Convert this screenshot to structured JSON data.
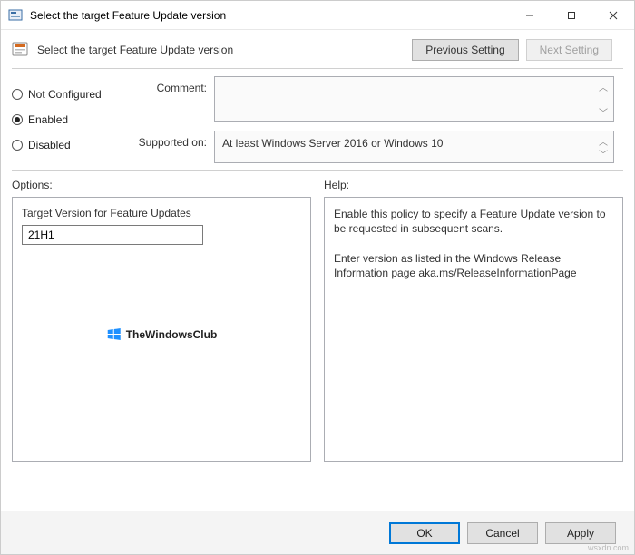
{
  "window": {
    "title": "Select the target Feature Update version"
  },
  "header": {
    "policy_title": "Select the target Feature Update version",
    "prev_btn": "Previous Setting",
    "next_btn": "Next Setting"
  },
  "config": {
    "radios": {
      "not_configured": "Not Configured",
      "enabled": "Enabled",
      "disabled": "Disabled",
      "selected": "enabled"
    },
    "comment_label": "Comment:",
    "comment_value": "",
    "supported_label": "Supported on:",
    "supported_value": "At least Windows Server 2016 or Windows 10"
  },
  "panels": {
    "options_label": "Options:",
    "help_label": "Help:"
  },
  "options": {
    "target_version_label": "Target Version for Feature Updates",
    "target_version_value": "21H1",
    "watermark_text": "TheWindowsClub"
  },
  "help": {
    "text": "Enable this policy to specify a Feature Update version to be requested in subsequent scans.\n\nEnter version as listed in the Windows Release Information page aka.ms/ReleaseInformationPage"
  },
  "footer": {
    "ok": "OK",
    "cancel": "Cancel",
    "apply": "Apply"
  },
  "attribution": "wsxdn.com"
}
